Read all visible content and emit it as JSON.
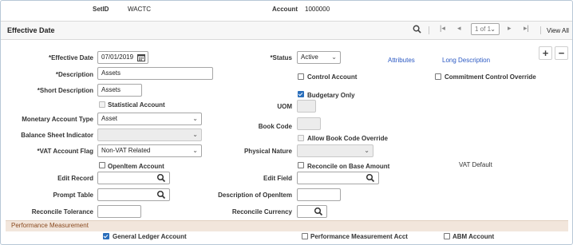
{
  "header": {
    "setid_label": "SetID",
    "setid_value": "WACTC",
    "account_label": "Account",
    "account_value": "1000000"
  },
  "section": {
    "title": "Effective Date",
    "pager": "1 of 1",
    "view_all": "View All"
  },
  "form": {
    "effective_date_label": "*Effective Date",
    "effective_date_value": "07/01/2019",
    "status_label": "*Status",
    "status_value": "Active",
    "attributes_link": "Attributes",
    "long_description_link": "Long Description",
    "description_label": "*Description",
    "description_value": "Assets",
    "short_description_label": "*Short Description",
    "short_description_value": "Assets",
    "control_account_label": "Control Account",
    "commitment_control_override_label": "Commitment Control Override",
    "budgetary_only_label": "Budgetary Only",
    "statistical_account_label": "Statistical Account",
    "uom_label": "UOM",
    "monetary_account_type_label": "Monetary Account Type",
    "monetary_account_type_value": "Asset",
    "book_code_label": "Book Code",
    "balance_sheet_indicator_label": "Balance Sheet Indicator",
    "balance_sheet_indicator_value": "",
    "allow_book_code_override_label": "Allow Book Code Override",
    "vat_account_flag_label": "*VAT Account Flag",
    "vat_account_flag_value": "Non-VAT Related",
    "physical_nature_label": "Physical Nature",
    "physical_nature_value": "",
    "openitem_account_label": "OpenItem Account",
    "reconcile_on_base_amount_label": "Reconcile on Base Amount",
    "vat_default_link": "VAT Default",
    "edit_record_label": "Edit Record",
    "edit_record_value": "",
    "edit_field_label": "Edit Field",
    "edit_field_value": "",
    "prompt_table_label": "Prompt Table",
    "prompt_table_value": "",
    "description_of_openitem_label": "Description of OpenItem",
    "description_of_openitem_value": "",
    "reconcile_tolerance_label": "Reconcile Tolerance",
    "reconcile_tolerance_value": "",
    "reconcile_currency_label": "Reconcile Currency",
    "reconcile_currency_value": ""
  },
  "performance": {
    "title": "Performance Measurement",
    "general_ledger_account_label": "General Ledger Account",
    "performance_measurement_acct_label": "Performance Measurement Acct",
    "abm_account_label": "ABM Account"
  },
  "colors": {
    "link": "#2b59c3",
    "checkbox_checked": "#2a6ebb",
    "pm_bar": "#f2e6dc"
  }
}
